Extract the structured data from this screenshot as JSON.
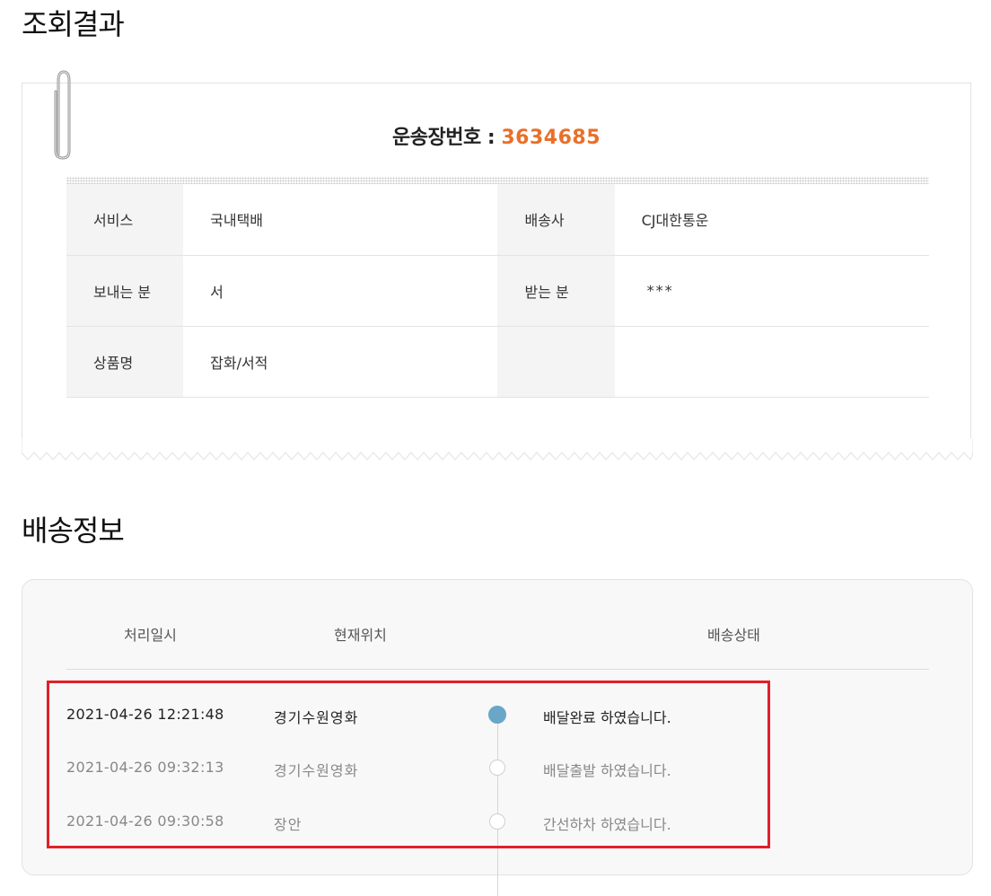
{
  "result_heading": "조회결과",
  "tracking": {
    "label": "운송장번호 :",
    "number": "3634685"
  },
  "info": {
    "service_label": "서비스",
    "service_value": "국내택배",
    "carrier_label": "배송사",
    "carrier_value": "CJ대한통운",
    "sender_label": "보내는 분",
    "sender_value": "서",
    "receiver_label": "받는 분",
    "receiver_value": "***",
    "product_label": "상품명",
    "product_value": "잡화/서적"
  },
  "delivery_heading": "배송정보",
  "columns": {
    "time": "처리일시",
    "location": "현재위치",
    "status": "배송상태"
  },
  "events": [
    {
      "time": "2021-04-26 12:21:48",
      "location": "경기수원영화",
      "status": "배달완료 하였습니다."
    },
    {
      "time": "2021-04-26 09:32:13",
      "location": "경기수원영화",
      "status": "배달출발 하였습니다."
    },
    {
      "time": "2021-04-26 09:30:58",
      "location": "장안",
      "status": "간선하차 하였습니다."
    }
  ],
  "colors": {
    "accent": "#e8702a",
    "timeline_active": "#6aa6c8",
    "highlight_border": "#e0202b"
  },
  "icons": [
    "paperclip-icon",
    "timeline-dot-icon"
  ]
}
